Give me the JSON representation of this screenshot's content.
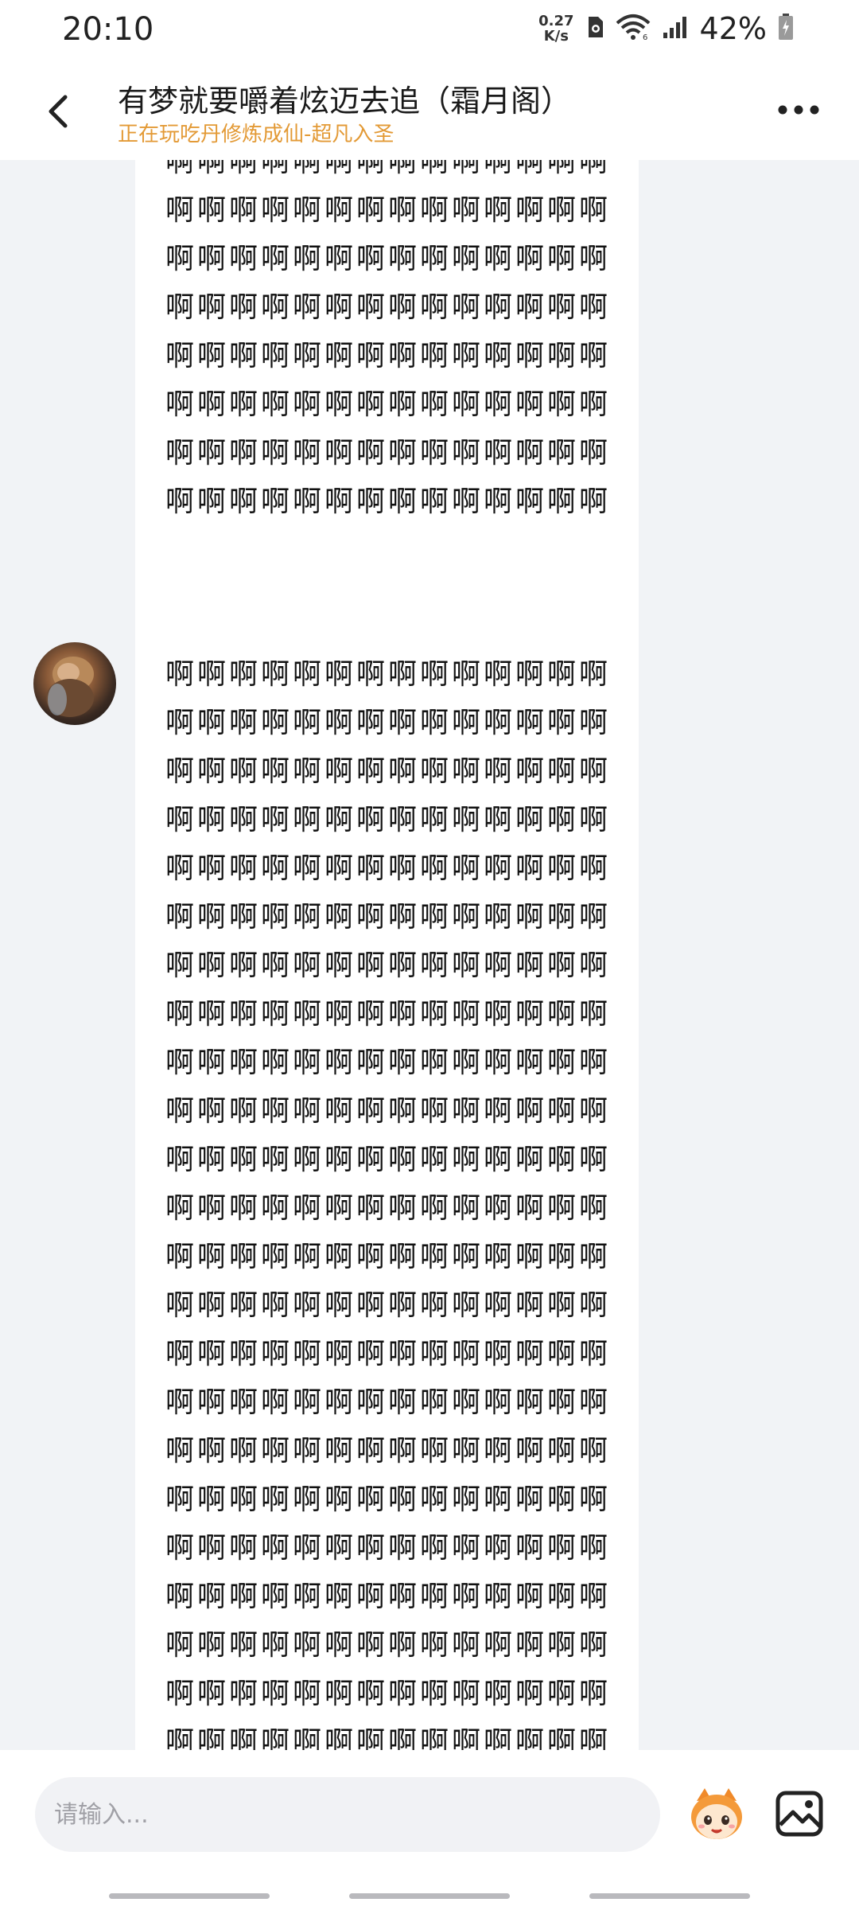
{
  "status_bar": {
    "time": "20:10",
    "net_speed_value": "0.27",
    "net_speed_unit": "K/s",
    "battery": "42%",
    "icons": [
      "sim-icon",
      "wifi-icon",
      "signal-icon",
      "battery-icon"
    ]
  },
  "header": {
    "title": "有梦就要嚼着炫迈去追（霜月阁）",
    "subtitle": "正在玩吃丹修炼成仙-超凡入圣",
    "icons": [
      "back-icon",
      "more-icon"
    ]
  },
  "messages": [
    {
      "text": "啊啊啊啊啊啊啊啊啊啊啊啊啊啊啊啊啊啊啊啊啊啊啊啊啊啊啊啊啊啊啊啊啊啊啊啊啊啊啊啊啊啊啊啊啊啊啊啊啊啊啊啊啊啊啊啊啊啊啊啊啊啊啊啊啊啊啊啊啊啊啊啊啊啊啊啊啊啊啊啊啊啊啊啊啊啊啊啊啊啊啊啊啊啊啊啊啊啊啊啊啊啊啊啊啊啊啊啊啊啊啊啊"
    },
    {
      "text": "啊啊啊啊啊啊啊啊啊啊啊啊啊啊啊啊啊啊啊啊啊啊啊啊啊啊啊啊啊啊啊啊啊啊啊啊啊啊啊啊啊啊啊啊啊啊啊啊啊啊啊啊啊啊啊啊啊啊啊啊啊啊啊啊啊啊啊啊啊啊啊啊啊啊啊啊啊啊啊啊啊啊啊啊啊啊啊啊啊啊啊啊啊啊啊啊啊啊啊啊啊啊啊啊啊啊啊啊啊啊啊啊啊啊啊啊啊啊啊啊啊啊啊啊啊啊啊啊啊啊啊啊啊啊啊啊啊啊啊啊啊啊啊啊啊啊啊啊啊啊啊啊啊啊啊啊啊啊啊啊啊啊啊啊啊啊啊啊啊啊啊啊啊啊啊啊啊啊啊啊啊啊啊啊啊啊啊啊啊啊啊啊啊啊啊啊啊啊啊啊啊啊啊啊啊啊啊啊啊啊啊啊啊啊啊啊啊啊啊啊啊啊啊啊啊啊啊啊啊啊啊啊啊啊啊啊啊啊啊啊啊啊啊啊啊啊啊啊啊啊啊啊啊啊啊啊啊啊啊啊啊啊啊啊啊啊啊啊啊啊啊啊啊啊啊啊啊啊啊啊啊啊啊啊啊啊啊啊啊啊啊啊啊啊啊啊啊啊啊啊啊啊啊啊啊啊啊啊啊啊啊啊啊啊啊啊啊啊啊啊啊啊啊啊啊啊啊啊啊啊啊啊啊啊啊啊啊啊啊啊啊啊啊啊啊啊啊啊啊"
    }
  ],
  "input": {
    "placeholder": "请输入...",
    "value": ""
  },
  "toolbar_icons": [
    "emoji-icon",
    "image-icon"
  ]
}
